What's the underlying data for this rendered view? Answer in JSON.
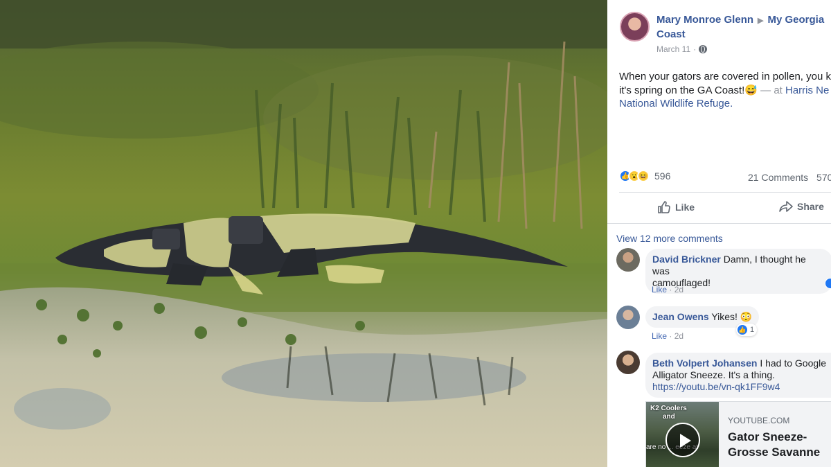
{
  "post": {
    "author": "Mary Monroe Glenn",
    "group": "My Georgia",
    "group_cont": "Coast",
    "date": "March 11",
    "text_line1": "When your gators are covered in pollen, you k",
    "text_line2_a": "it's spring on the GA Coast!",
    "text_line2_emoji": "😅",
    "text_line2_at": " — at ",
    "text_line2_link": "Harris Ne",
    "text_line3_link": "National Wildlife Refuge."
  },
  "reactions": {
    "count": "596",
    "icons": [
      "like-icon",
      "wow-icon",
      "haha-icon"
    ],
    "comments": "21 Comments",
    "shares_partial": "570"
  },
  "actions": {
    "like": "Like",
    "share": "Share"
  },
  "comments": {
    "view_more": "View 12 more comments",
    "items": [
      {
        "name": "David Brickner",
        "text_a": " Damn, I thought he was",
        "text_b": "camouflaged!",
        "like": "Like",
        "sep": " · ",
        "time": "2d"
      },
      {
        "name": "Jean Owens",
        "text_a": " Yikes! ",
        "emoji": "😳",
        "like": "Like",
        "sep": " · ",
        "time": "2d",
        "reaction_count": "1"
      },
      {
        "name": "Beth Volpert Johansen",
        "text_a": " I had to Google",
        "text_b": "Alligator Sneeze. It's a thing.",
        "url": "https://youtu.be/vn-qk1FF9w4"
      }
    ]
  },
  "link_card": {
    "thumb_caption": "K2 Coolers",
    "thumb_caption2": "and",
    "thumb_caption3": "are no ... eeze at",
    "source": "YOUTUBE.COM",
    "title_line1": "Gator Sneeze-",
    "title_line2": "Grosse Savanne"
  },
  "colors": {
    "link": "#385898",
    "like_blue": "#2078f4",
    "muted": "#90949c",
    "bubble": "#f2f3f5"
  }
}
